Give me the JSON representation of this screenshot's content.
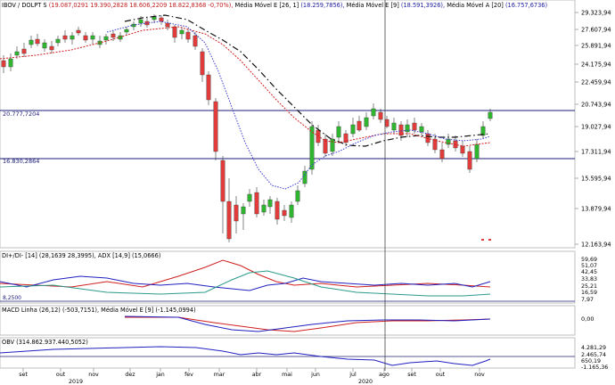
{
  "main": {
    "legend_title": "IBOV / DOLPT S",
    "legend_ohlc": "(19.087,0291  19.390,2828  18.606,2209  18.822,8368  -0,70%),",
    "legend_ma26_label": "Média Móvel E [26, 1]",
    "legend_ma26_val": "(18.259,7856),",
    "legend_ma9_label": "Média Móvel E [9]",
    "legend_ma9_val": "(18.591,3926),",
    "legend_ma20_label": "Média Móvel A [20]",
    "legend_ma20_val": "(16.757,6736)",
    "hline_upper_label": "20.777,7204",
    "hline_lower_label": "16.830,2864",
    "price_ticks": [
      "29.323,94",
      "27.607,94",
      "25.891,94",
      "24.175,94",
      "22.459,94",
      "20.743,94",
      "19.027,94",
      "17.311,94",
      "15.595,94",
      "13.879,94",
      "12.163,94"
    ]
  },
  "adx": {
    "legend": "DI+/DI- [14] (28,1639  28,3995), ADX [14,9] (15,0666)",
    "hline_label": "8,2500",
    "ticks": [
      "59,69",
      "51,07",
      "42,45",
      "33,83",
      "25,21",
      "16,59",
      "7,97"
    ]
  },
  "macd": {
    "legend": "MACD Linha (26,12) (-503,7151), Média Móvel E [9] (-1.145,0994)",
    "ticks": [
      "0,00"
    ]
  },
  "obv": {
    "legend": "OBV (314.862.937.440,5052)",
    "ticks": [
      "4.281,29",
      "2.465,74",
      "650,19",
      "-1.165,36"
    ]
  },
  "xaxis": {
    "months": [
      "set",
      "out",
      "nov",
      "dez",
      "jan",
      "fev",
      "mar",
      "abr",
      "mai",
      "jun",
      "jul",
      "ago",
      "set",
      "out",
      "nov"
    ],
    "years": [
      "2019",
      "2020"
    ]
  },
  "colors": {
    "up": "#2fb52f",
    "down": "#e03c3c",
    "ma26": "#111111",
    "ma9": "#3a3ad0",
    "ma20": "#d02020",
    "hline": "#1c1c7a"
  }
}
